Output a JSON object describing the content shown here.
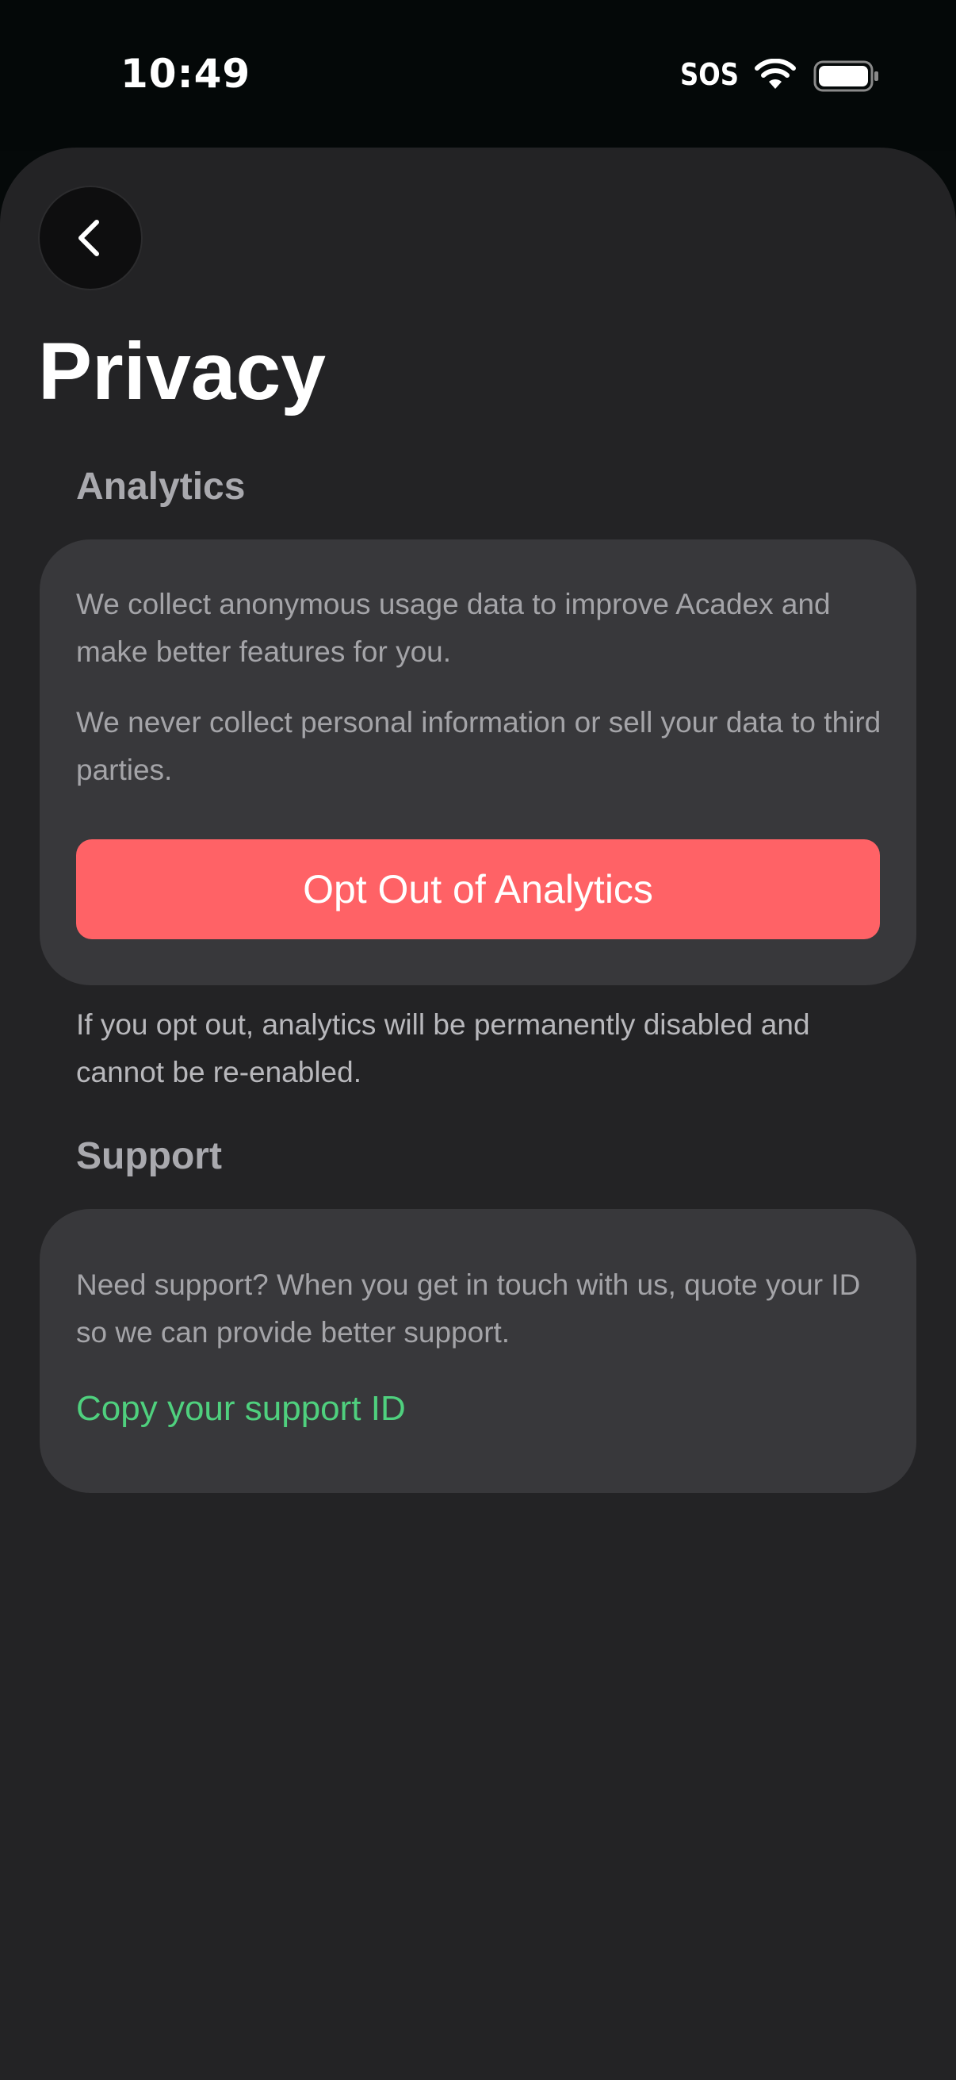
{
  "status_bar": {
    "time": "10:49",
    "sos": "SOS",
    "wifi_icon": "wifi-icon",
    "battery_icon": "battery-icon"
  },
  "nav": {
    "back_icon": "chevron-left-icon"
  },
  "page": {
    "title": "Privacy"
  },
  "analytics": {
    "header": "Analytics",
    "paragraph_1": "We collect anonymous usage data to improve Acadex and make better features for you.",
    "paragraph_2": "We never collect personal information or sell your data to third parties.",
    "opt_out_label": "Opt Out of Analytics",
    "footnote": "If you opt out, analytics will be permanently disabled and cannot be re-enabled."
  },
  "support": {
    "header": "Support",
    "paragraph": "Need support? When you get in touch with us, quote your ID so we can provide better support.",
    "copy_link_label": "Copy your support ID"
  },
  "colors": {
    "background": "#232325",
    "card": "#38383b",
    "accent_red": "#ff6266",
    "accent_green": "#4fd07e"
  }
}
